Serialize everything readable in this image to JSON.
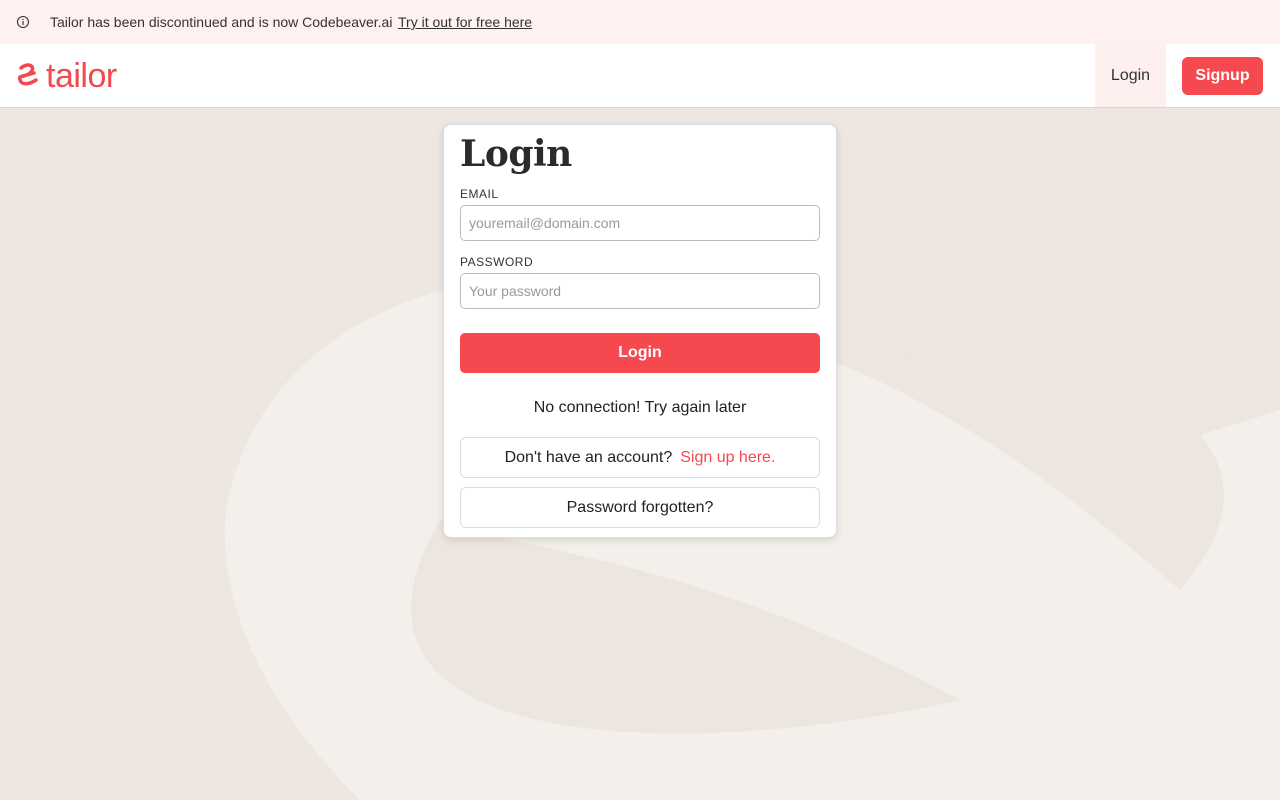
{
  "banner": {
    "icon": "info-icon",
    "text": "Tailor has been discontinued and is now Codebeaver.ai",
    "link_text": "Try it out for free here"
  },
  "header": {
    "logo_icon": "tailor-logo-icon",
    "logo_text": "tailor",
    "nav_login": "Login",
    "nav_signup": "Signup"
  },
  "login_form": {
    "title": "Login",
    "email_label": "EMAIL",
    "email_placeholder": "youremail@domain.com",
    "email_value": "",
    "password_label": "PASSWORD",
    "password_placeholder": "Your password",
    "password_value": "",
    "submit_label": "Login",
    "error_message": "No connection! Try again later",
    "signup_prompt": "Don't have an account?",
    "signup_link": "Sign up here.",
    "forgot_password": "Password forgotten?"
  },
  "colors": {
    "accent": "#f5484f",
    "banner_bg": "#fff1f0",
    "page_bg": "#f3efea"
  }
}
